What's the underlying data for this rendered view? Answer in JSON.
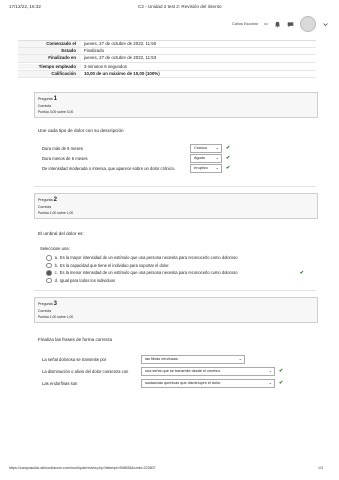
{
  "print_header": {
    "datetime": "17/12/22, 16:32",
    "page_title": "C2 - Unidad 2 test 2: Revisión del intento"
  },
  "userbar": {
    "user_name": "Carlos Escobar",
    "user_suffix": "•••",
    "icons": [
      "bell-icon",
      "chat-icon",
      "avatar",
      "chevron-down-icon"
    ]
  },
  "summary": {
    "rows": [
      {
        "label": "Comenzado el",
        "value": "jueves, 27 de octubre de 2022, 11:50"
      },
      {
        "label": "Estado",
        "value": "Finalizado"
      },
      {
        "label": "Finalizado en",
        "value": "jueves, 27 de octubre de 2022, 11:53"
      },
      {
        "label": "Tiempo empleado",
        "value": "3 minutos 6 segundos"
      },
      {
        "label": "Calificación",
        "value": "10,00 de un máximo de 10,00 (100%)"
      }
    ]
  },
  "questions": [
    {
      "prefix": "Pregunta",
      "number": "1",
      "status": "Correcta",
      "score": "Puntúa 3,00 sobre 3,00",
      "text": "Une cada tipo de dolor con su descripción",
      "matches": [
        {
          "prompt": "Dura más de 6 meses",
          "answer": "Crónico"
        },
        {
          "prompt": "Dura menos de 6 meses",
          "answer": "Agudo"
        },
        {
          "prompt": "De intensidad moderada o intensa, que aparece sobre un dolor crónico.",
          "answer": "Irruptivo"
        }
      ]
    },
    {
      "prefix": "Pregunta",
      "number": "2",
      "status": "Correcta",
      "score": "Puntúa 1,00 sobre 1,00",
      "text": "El umbral del dolor es:",
      "select_label": "Seleccione una:",
      "options": [
        {
          "letter": "a.",
          "text": "Es la mayor intensidad de un estímulo que una persona necesita para reconocerlo como doloroso",
          "correct": false
        },
        {
          "letter": "b.",
          "text": "Es la capacidad que tiene el individuo para soportar el dolor.",
          "correct": false
        },
        {
          "letter": "c.",
          "text": "Es la menor intensidad de un estímulo que una persona necesita para reconocerlo como doloroso",
          "correct": true
        },
        {
          "letter": "d.",
          "text": "Igual para todos los individuos",
          "correct": false
        }
      ]
    },
    {
      "prefix": "Pregunta",
      "number": "3",
      "status": "Correcta",
      "score": "Puntúa 1,00 sobre 1,00",
      "text": "Finaliza las frases de forma correcta",
      "matches": [
        {
          "prompt": "La señal dolorosa se transmite por",
          "answer": "las fibras nerviosas."
        },
        {
          "prompt": "La disminución o alivio del dolor comienza con",
          "answer": "una señal que se transmite desde el cerebro."
        },
        {
          "prompt": "Las endorfinas son",
          "answer": "sustancias químicas que disminuyen el dolor."
        }
      ]
    }
  ],
  "print_footer": {
    "url": "https://campusclick.aleixcollacom.com/mod/quiz/review.php?attempt=598636&cmid=223807",
    "page": "1/3"
  }
}
